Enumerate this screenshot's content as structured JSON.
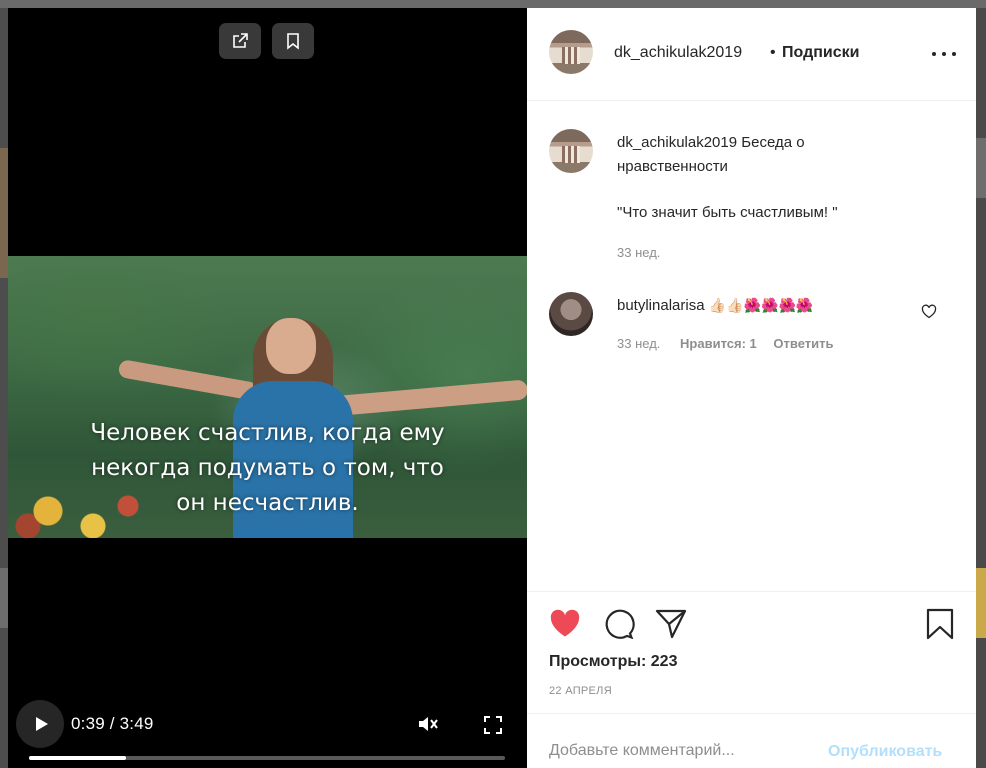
{
  "video": {
    "caption_lines": [
      "Человек счастлив,  когда ему",
      "некогда подумать о том, что",
      "он несчастлив."
    ],
    "time": "0:39 / 3:49",
    "progress_fraction": 0.204,
    "icons": [
      "share-external-icon",
      "bookmark-icon",
      "play-icon",
      "muted-speaker-icon",
      "fullscreen-icon"
    ]
  },
  "header": {
    "username": "dk_achikulak2019",
    "dot": "•",
    "follow_label": "Подписки"
  },
  "caption_comment": {
    "username": "dk_achikulak2019",
    "text_line1": " Беседа о",
    "text_line2": "нравственности",
    "quote": "\"Что значит быть счастливым! \"",
    "time": "33 нед."
  },
  "comments": [
    {
      "username": "butylinalarisa",
      "text": "👍🏻👍🏻🌺🌺🌺🌺",
      "time": "33 нед.",
      "likes": "Нравится: 1",
      "reply": "Ответить"
    }
  ],
  "actions": {
    "views": "Просмотры: 223",
    "date": "22 АПРЕЛЯ",
    "liked": true,
    "like_color": "#ed4956"
  },
  "add_comment": {
    "placeholder": "Добавьте комментарий...",
    "publish_label": "Опубликовать",
    "publish_color": "#b2dffc"
  }
}
